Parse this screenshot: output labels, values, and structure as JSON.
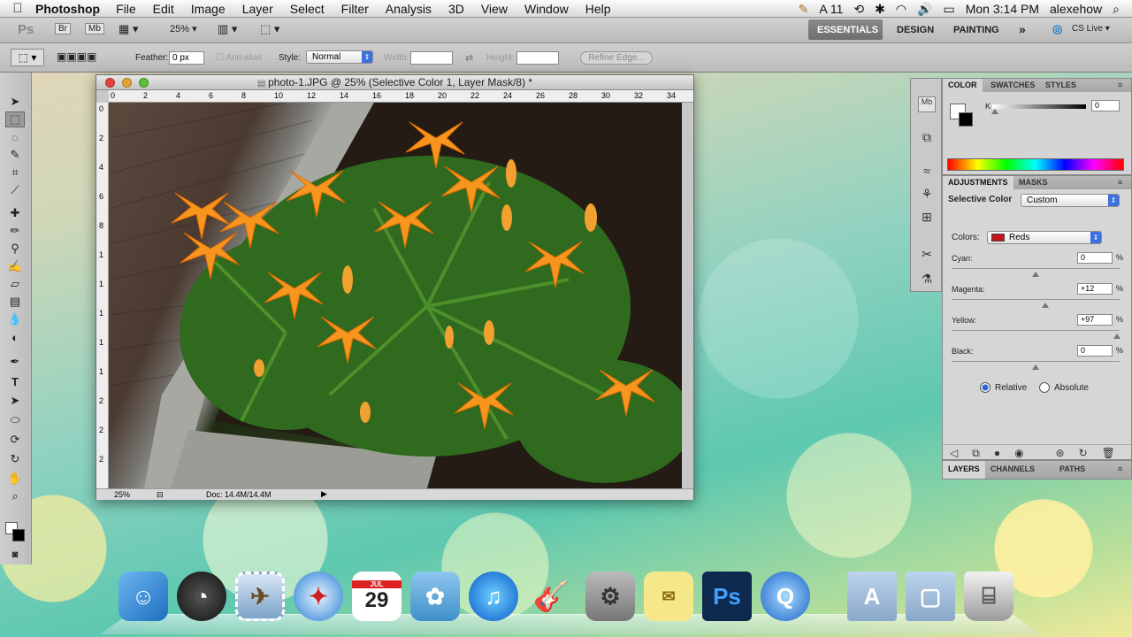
{
  "menubar": {
    "apple_icon": "apple-icon",
    "app_name": "Photoshop",
    "items": [
      "File",
      "Edit",
      "Image",
      "Layer",
      "Select",
      "Filter",
      "Analysis",
      "3D",
      "View",
      "Window",
      "Help"
    ],
    "status": {
      "adobe_count": "11",
      "clock": "Mon 3:14 PM",
      "user": "alexehow"
    }
  },
  "appbar": {
    "ps_label": "Ps",
    "br_label": "Br",
    "mb_label": "Mb",
    "zoom": "25%",
    "workspaces": [
      "ESSENTIALS",
      "DESIGN",
      "PAINTING"
    ],
    "more": "»",
    "cslive": "CS Live"
  },
  "optionsbar": {
    "feather_label": "Feather:",
    "feather_value": "0 px",
    "antialias_label": "Anti-alias",
    "style_label": "Style:",
    "style_value": "Normal",
    "width_label": "Width:",
    "height_label": "Height:",
    "refine_label": "Refine Edge..."
  },
  "document": {
    "title": "photo-1.JPG @ 25% (Selective Color 1, Layer Mask/8) *",
    "ruler_h": [
      "0",
      "2",
      "4",
      "6",
      "8",
      "10",
      "12",
      "14",
      "16",
      "18",
      "20",
      "22",
      "24",
      "26",
      "28",
      "30",
      "32",
      "34"
    ],
    "ruler_v": [
      "0",
      "2",
      "4",
      "6",
      "8",
      "1",
      "1",
      "1",
      "1",
      "1",
      "2",
      "2",
      "2"
    ],
    "zoom_status": "25%",
    "doc_status": "Doc: 14.4M/14.4M"
  },
  "color_panel": {
    "tabs": [
      "COLOR",
      "SWATCHES",
      "STYLES"
    ],
    "k_label": "K",
    "k_value": "0"
  },
  "adjustments": {
    "tabs": [
      "ADJUSTMENTS",
      "MASKS"
    ],
    "title": "Selective Color",
    "preset": "Custom",
    "colors_label": "Colors:",
    "colors_value": "Reds",
    "swatch_color": "#c4161c",
    "sliders": [
      {
        "label": "Cyan:",
        "value": "0",
        "unit": "%",
        "level": 0
      },
      {
        "label": "Magenta:",
        "value": "+12",
        "unit": "%",
        "level": 12
      },
      {
        "label": "Yellow:",
        "value": "+97",
        "unit": "%",
        "level": 97
      },
      {
        "label": "Black:",
        "value": "0",
        "unit": "%",
        "level": 0
      }
    ],
    "method_relative": "Relative",
    "method_absolute": "Absolute",
    "method_selected": "Relative"
  },
  "layers_panel": {
    "tabs": [
      "LAYERS",
      "CHANNELS",
      "PATHS"
    ]
  },
  "dock": {
    "items": [
      "finder-icon",
      "dashboard-icon",
      "mail-stamp-icon",
      "safari-icon",
      "ical-icon",
      "iphoto-icon",
      "itunes-icon",
      "garageband-icon",
      "system-preferences-icon",
      "stickies-icon",
      "photoshop-icon",
      "quicktime-icon",
      "applications-folder-icon",
      "documents-folder-icon",
      "trash-icon"
    ],
    "ical_day": "29",
    "ical_month": "JUL",
    "photoshop_label": "Ps"
  }
}
